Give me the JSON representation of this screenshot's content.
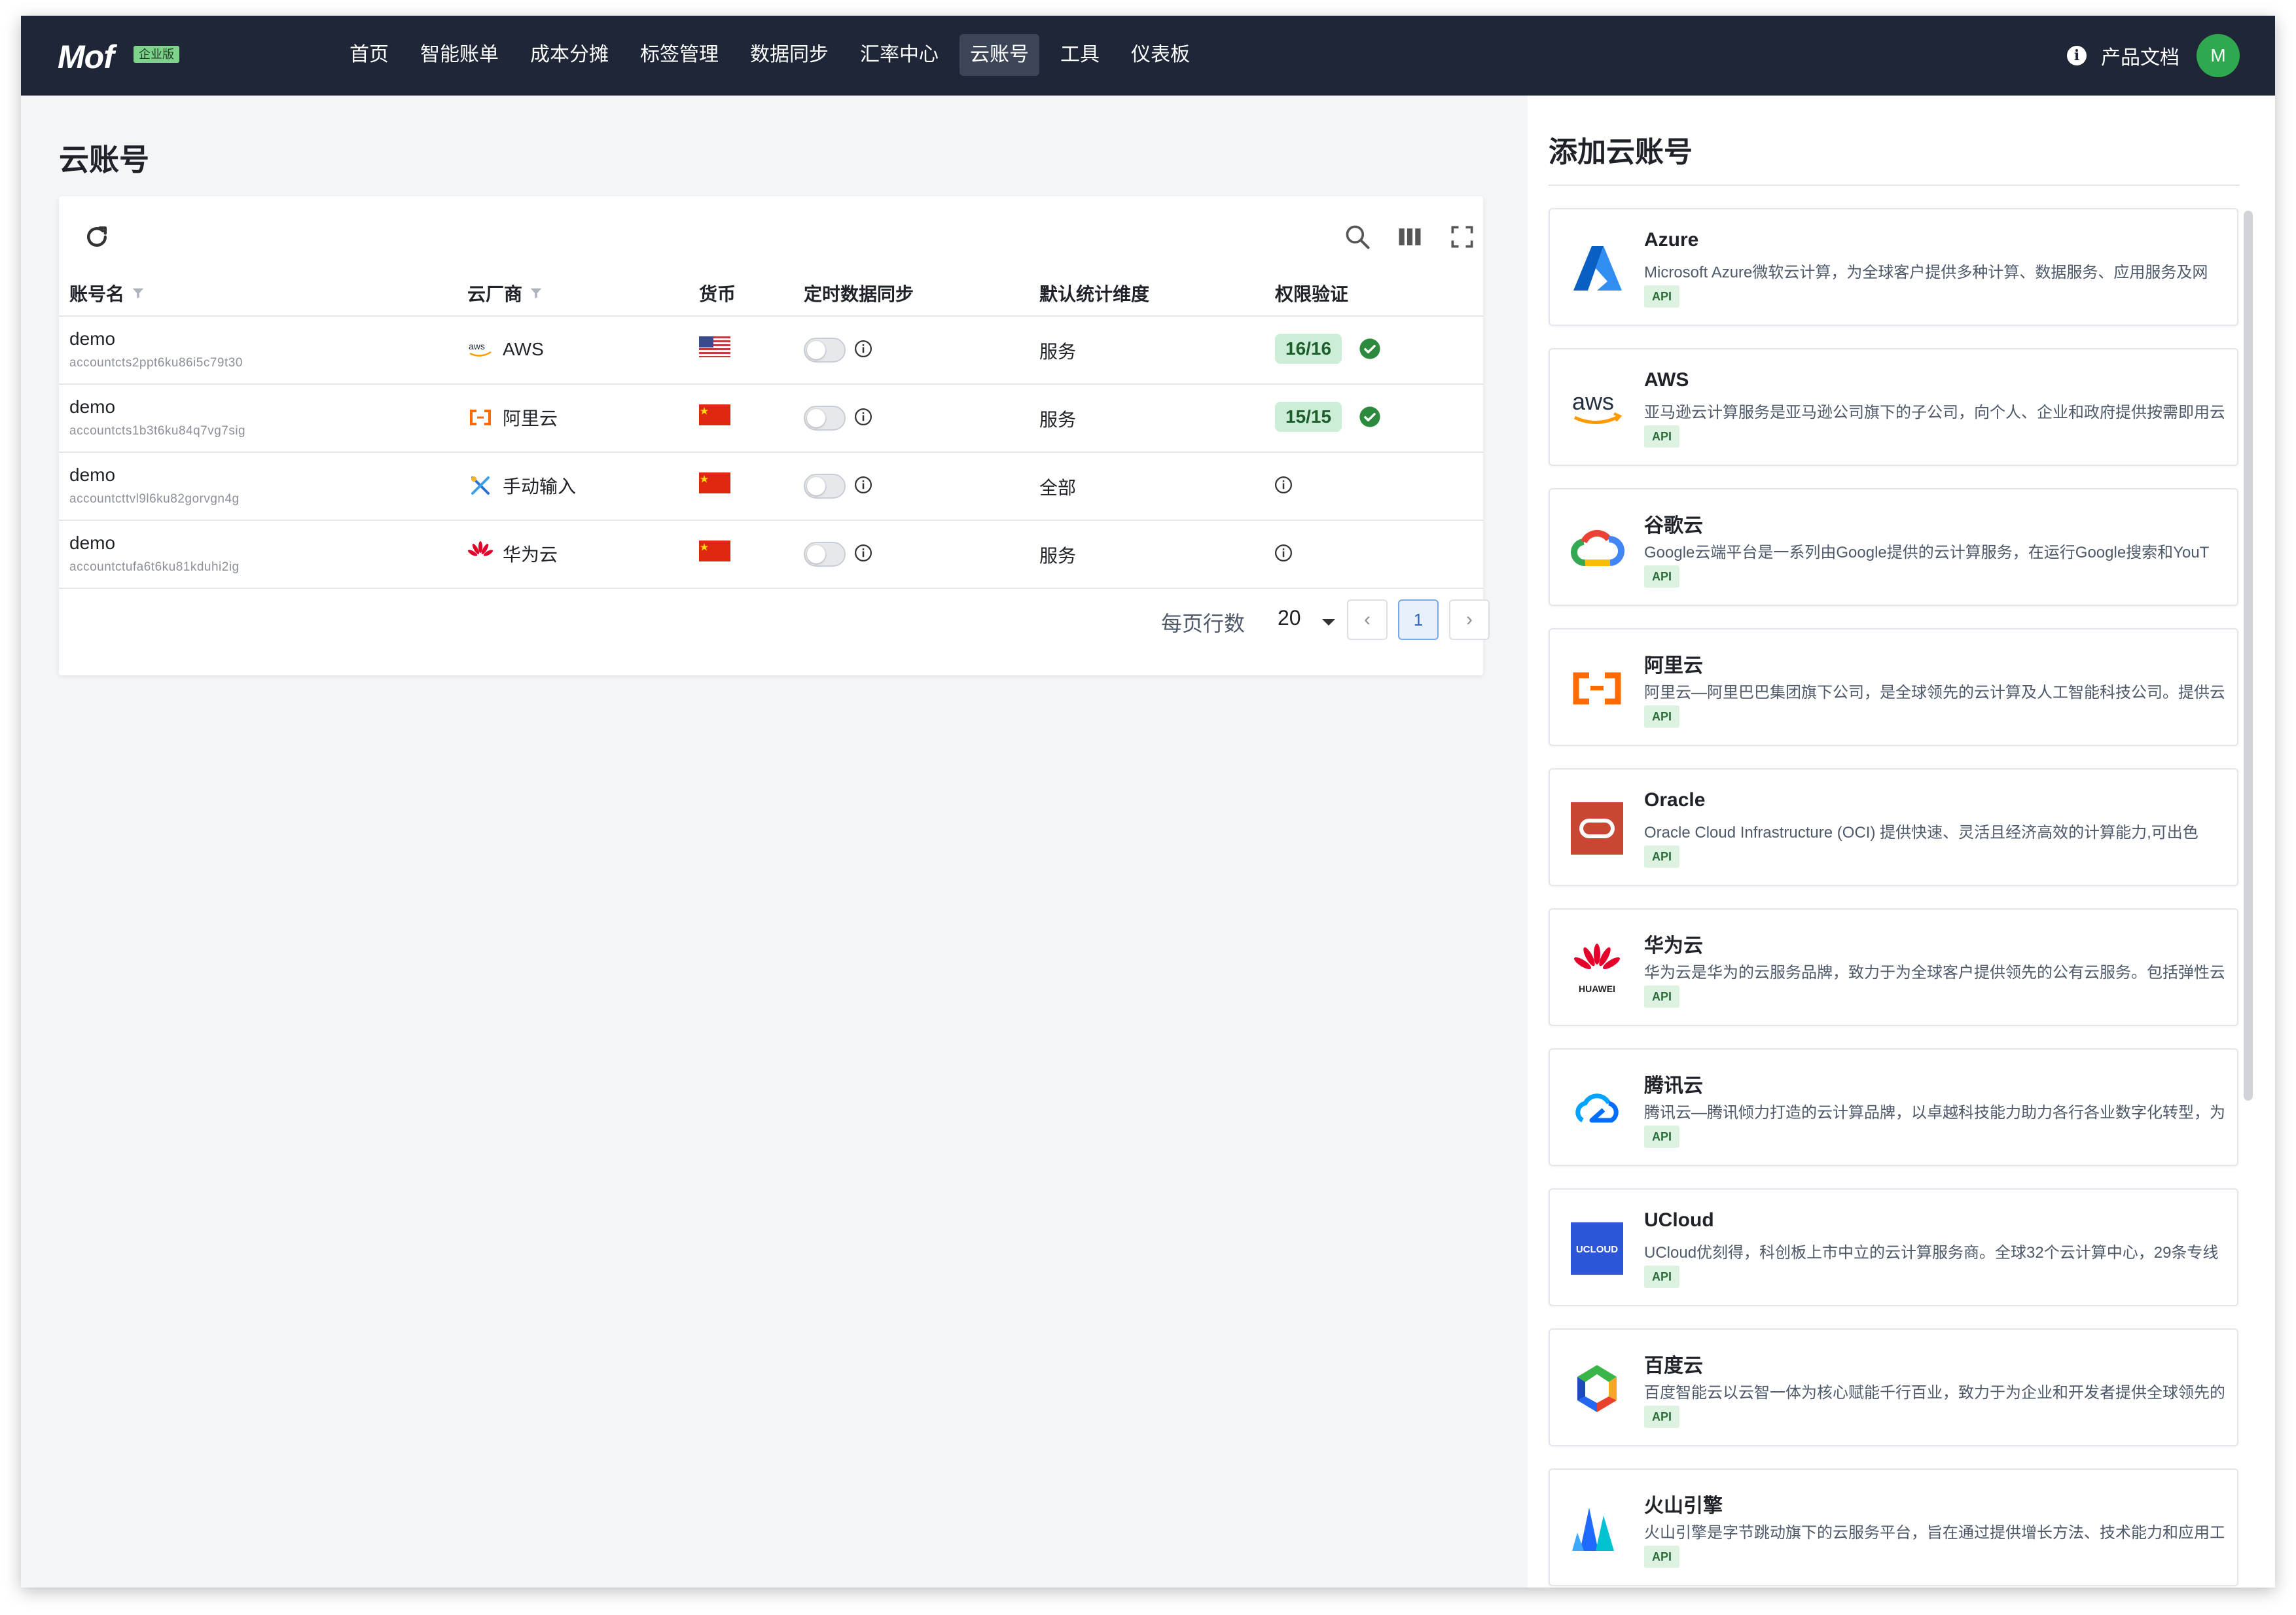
{
  "app": {
    "logo": "Mof",
    "edition": "企业版"
  },
  "nav": {
    "items": [
      "首页",
      "智能账单",
      "成本分摊",
      "标签管理",
      "数据同步",
      "汇率中心",
      "云账号",
      "工具",
      "仪表板"
    ],
    "active": "云账号"
  },
  "header_right": {
    "docs": "产品文档",
    "avatar_initial": "M"
  },
  "page": {
    "title": "云账号"
  },
  "table": {
    "columns": {
      "account": "账号名",
      "vendor": "云厂商",
      "currency": "货币",
      "sync": "定时数据同步",
      "dimension": "默认统计维度",
      "permission": "权限验证"
    },
    "rows": [
      {
        "name": "demo",
        "id": "accountcts2ppt6ku86i5c79t30",
        "vendor": "AWS",
        "vendor_icon": "aws-icon",
        "currency_flag": "us-flag",
        "sync_on": false,
        "dimension": "服务",
        "permission": "16/16",
        "verified": true
      },
      {
        "name": "demo",
        "id": "accountcts1b3t6ku84q7vg7sig",
        "vendor": "阿里云",
        "vendor_icon": "aliyun-icon",
        "currency_flag": "cn-flag",
        "sync_on": false,
        "dimension": "服务",
        "permission": "15/15",
        "verified": true
      },
      {
        "name": "demo",
        "id": "accountcttvl9l6ku82gorvgn4g",
        "vendor": "手动输入",
        "vendor_icon": "manual-input-icon",
        "currency_flag": "cn-flag",
        "sync_on": false,
        "dimension": "全部",
        "permission": "",
        "verified": false
      },
      {
        "name": "demo",
        "id": "accountctufa6t6ku81kduhi2ig",
        "vendor": "华为云",
        "vendor_icon": "huawei-icon",
        "currency_flag": "cn-flag",
        "sync_on": false,
        "dimension": "服务",
        "permission": "",
        "verified": false
      }
    ],
    "pager": {
      "label": "每页行数",
      "page_size": "20",
      "current_page": "1",
      "prev": "‹",
      "next": "›"
    }
  },
  "side": {
    "title": "添加云账号",
    "vendors": [
      {
        "name": "Azure",
        "desc": "Microsoft Azure微软云计算，为全球客户提供多种计算、数据服务、应用服务及网",
        "tag": "API",
        "icon": "azure-logo"
      },
      {
        "name": "AWS",
        "desc": "亚马逊云计算服务是亚马逊公司旗下的子公司，向个人、企业和政府提供按需即用云",
        "tag": "API",
        "icon": "aws-logo"
      },
      {
        "name": "谷歌云",
        "desc": "Google云端平台是一系列由Google提供的云计算服务，在运行Google搜索和YouT",
        "tag": "API",
        "icon": "google-cloud-logo"
      },
      {
        "name": "阿里云",
        "desc": "阿里云—阿里巴巴集团旗下公司，是全球领先的云计算及人工智能科技公司。提供云",
        "tag": "API",
        "icon": "aliyun-logo"
      },
      {
        "name": "Oracle",
        "desc": "Oracle Cloud Infrastructure (OCI) 提供快速、灵活且经济高效的计算能力,可出色",
        "tag": "API",
        "icon": "oracle-logo"
      },
      {
        "name": "华为云",
        "desc": "华为云是华为的云服务品牌，致力于为全球客户提供领先的公有云服务。包括弹性云",
        "tag": "API",
        "icon": "huawei-logo",
        "icon_text": "HUAWEI"
      },
      {
        "name": "腾讯云",
        "desc": "腾讯云—腾讯倾力打造的云计算品牌，以卓越科技能力助力各行各业数字化转型，为",
        "tag": "API",
        "icon": "tencent-cloud-logo"
      },
      {
        "name": "UCloud",
        "desc": "UCloud优刻得，科创板上市中立的云计算服务商。全球32个云计算中心，29条专线",
        "tag": "API",
        "icon": "ucloud-logo",
        "icon_text": "UCLOUD"
      },
      {
        "name": "百度云",
        "desc": "百度智能云以云智一体为核心赋能千行百业，致力于为企业和开发者提供全球领先的",
        "tag": "API",
        "icon": "baidu-cloud-logo"
      },
      {
        "name": "火山引擎",
        "desc": "火山引擎是字节跳动旗下的云服务平台，旨在通过提供增长方法、技术能力和应用工",
        "tag": "API",
        "icon": "volcengine-logo"
      }
    ]
  },
  "colors": {
    "nav_bg": "#1e2638",
    "accent_green": "#2fa84f",
    "badge_bg": "#cdeed6"
  }
}
